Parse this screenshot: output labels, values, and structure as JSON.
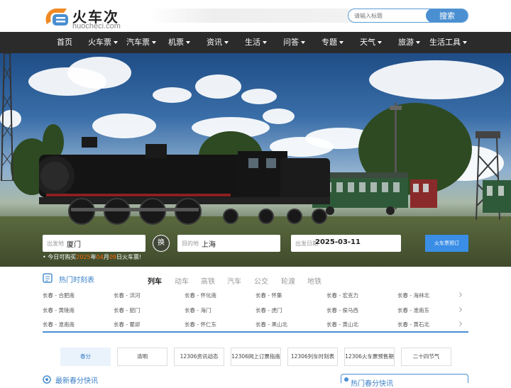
{
  "brand": {
    "name_cn": "火车次",
    "domain": "huocheci.com",
    "colors": {
      "blue": "#4a8fd1",
      "orange": "#f08a24"
    }
  },
  "search": {
    "placeholder": "请输入标题",
    "button_label": "搜索"
  },
  "nav": [
    {
      "label": "首页",
      "dropdown": false
    },
    {
      "label": "火车票",
      "dropdown": true
    },
    {
      "label": "汽车票",
      "dropdown": true
    },
    {
      "label": "机票",
      "dropdown": true
    },
    {
      "label": "资讯",
      "dropdown": true
    },
    {
      "label": "生活",
      "dropdown": true
    },
    {
      "label": "问答",
      "dropdown": true
    },
    {
      "label": "专题",
      "dropdown": true
    },
    {
      "label": "天气",
      "dropdown": true
    },
    {
      "label": "旅游",
      "dropdown": true
    },
    {
      "label": "生活工具",
      "dropdown": true
    }
  ],
  "booking": {
    "from_label": "出发地",
    "from_value": "厦门",
    "swap_label": "换",
    "to_label": "目的地",
    "to_value": "上海",
    "date_label": "出发日期",
    "date_value": "2025-03-11",
    "submit_label": "火车票预订",
    "notice_prefix": "今日可购买",
    "notice_year": "2025",
    "notice_year_unit": "年",
    "notice_month": "04",
    "notice_month_unit": "月",
    "notice_day": "09",
    "notice_suffix": "日火车票!"
  },
  "schedule": {
    "title": "热门时刻表",
    "tabs": [
      "列车",
      "动车",
      "高铁",
      "汽车",
      "公交",
      "轮渡",
      "地铁"
    ],
    "active_tab": "列车",
    "routes": [
      [
        "长春 - 合肥南",
        "长春 - 洪河",
        "长春 - 怀化南",
        "长春 - 怀集",
        "长春 - 宏克力",
        "长春 - 海林北"
      ],
      [
        "长春 - 黄陵南",
        "长春 - 韶门",
        "长春 - 海门",
        "长春 - 虎门",
        "长春 - 侯马西",
        "长春 - 淮南东"
      ],
      [
        "长春 - 淮南南",
        "长春 - 瞿邱",
        "长春 - 怀仁东",
        "长春 - 黑山北",
        "长春 - 黄山北",
        "长春 - 黄石北"
      ]
    ]
  },
  "topics": [
    "春分",
    "清明",
    "12306资讯动态",
    "12306网上订票指南",
    "12306列车时刻表",
    "12306火车票预售期",
    "二十四节气"
  ],
  "footer_sections": {
    "news_title": "最新春分快讯",
    "right_title": "热门春分快讯"
  }
}
